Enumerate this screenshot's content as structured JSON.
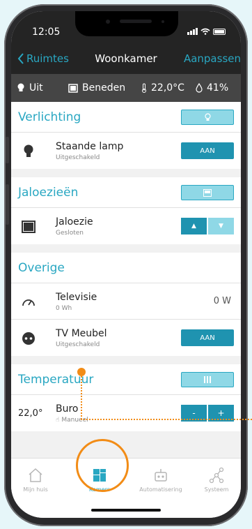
{
  "status": {
    "time": "12:05"
  },
  "nav": {
    "back_label": "Ruimtes",
    "title": "Woonkamer",
    "edit_label": "Aanpassen"
  },
  "info": {
    "light": "Uit",
    "floor": "Beneden",
    "temperature": "22,0°C",
    "humidity": "41%"
  },
  "sections": {
    "lighting": {
      "title": "Verlichting",
      "row": {
        "name": "Staande lamp",
        "status": "Uitgeschakeld",
        "button": "AAN"
      }
    },
    "blinds": {
      "title": "Jaloezieën",
      "row": {
        "name": "Jaloezie",
        "status": "Gesloten"
      }
    },
    "other": {
      "title": "Overige",
      "tv": {
        "name": "Televisie",
        "status": "0 Wh",
        "power": "0 W"
      },
      "furniture": {
        "name": "TV Meubel",
        "status": "Uitgeschakeld",
        "button": "AAN"
      }
    },
    "temperature": {
      "title": "Temperatuur",
      "row": {
        "value": "22,0°",
        "name": "Buro",
        "mode": "Manueel",
        "minus": "-",
        "plus": "+"
      }
    }
  },
  "tabs": [
    {
      "label": "Mijn huis"
    },
    {
      "label": "Kamers"
    },
    {
      "label": "Automatisering"
    },
    {
      "label": "Systeem"
    }
  ],
  "colors": {
    "accent": "#29a7c2",
    "button": "#1f93b0",
    "highlight": "#f28c16"
  }
}
